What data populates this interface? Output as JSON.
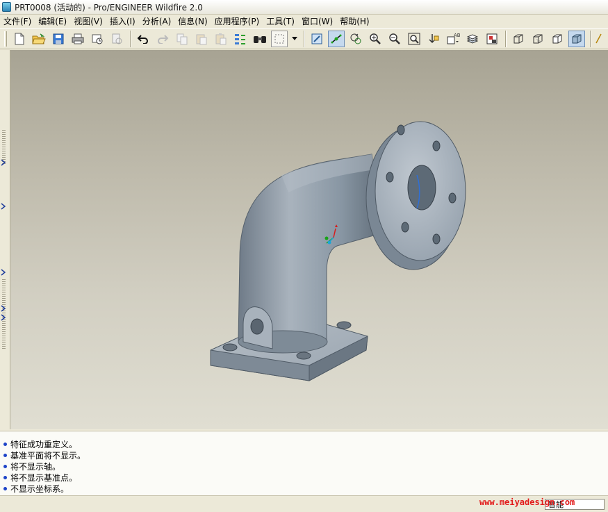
{
  "window": {
    "title": "PRT0008 (活动的) - Pro/ENGINEER Wildfire 2.0"
  },
  "menu": [
    {
      "label": "文件(F)"
    },
    {
      "label": "编辑(E)"
    },
    {
      "label": "视图(V)"
    },
    {
      "label": "插入(I)"
    },
    {
      "label": "分析(A)"
    },
    {
      "label": "信息(N)"
    },
    {
      "label": "应用程序(P)"
    },
    {
      "label": "工具(T)"
    },
    {
      "label": "窗口(W)"
    },
    {
      "label": "帮助(H)"
    }
  ],
  "toolbar": {
    "icons": [
      "new-file-icon",
      "open-folder-icon",
      "save-icon",
      "print-icon",
      "send-mail-icon",
      "print-preview-icon",
      "undo-icon",
      "redo-icon",
      "copy-icon",
      "paste-icon",
      "paste-special-icon",
      "regenerate-icon",
      "find-icon",
      "select-box-icon",
      "dropdown-arrow-icon",
      "repaint-icon",
      "spin-center-icon",
      "orient-icon",
      "zoom-in-icon",
      "zoom-out-icon",
      "refit-icon",
      "reorient-icon",
      "saved-views-icon",
      "layers-icon",
      "view-manager-icon",
      "wireframe-icon",
      "hidden-line-icon",
      "no-hidden-icon",
      "shading-icon"
    ],
    "active": [
      "spin-center-icon",
      "shading-icon"
    ]
  },
  "messages": [
    "特征成功重定义。",
    "基准平面将不显示。",
    "将不显示轴。",
    "将不显示基准点。",
    "不显示坐标系。"
  ],
  "status": {
    "filter": "智能"
  },
  "watermark": "www.meiyadesign.com",
  "colors": {
    "model": "#8e9aa6",
    "viewport_top": "#a7a393",
    "viewport_bottom": "#e0ded2",
    "message_bullet": "#1d43c8"
  }
}
